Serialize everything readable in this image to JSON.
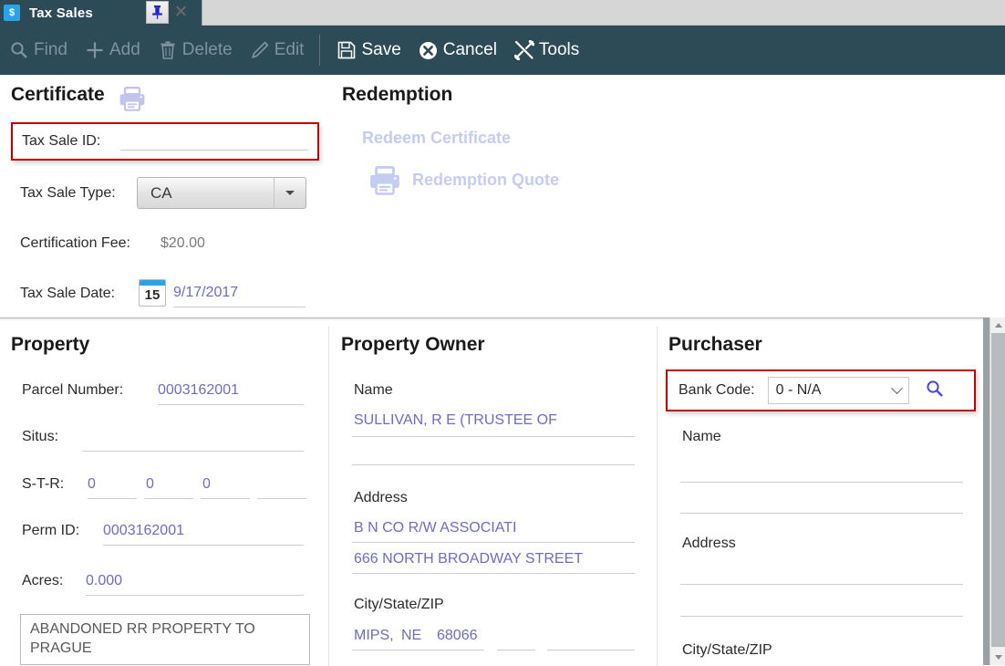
{
  "tab": {
    "app_icon": "tax-sales-app-icon",
    "title": "Tax Sales",
    "pin_glyph": "↓",
    "close_glyph": "✕"
  },
  "toolbar": {
    "items": [
      {
        "label": "Find",
        "icon": "search-icon",
        "enabled": false
      },
      {
        "label": "Add",
        "icon": "plus-icon",
        "enabled": false
      },
      {
        "label": "Delete",
        "icon": "trash-icon",
        "enabled": false
      },
      {
        "label": "Edit",
        "icon": "pencil-icon",
        "enabled": false
      },
      {
        "label": "Save",
        "icon": "floppy-disk-icon",
        "enabled": true
      },
      {
        "label": "Cancel",
        "icon": "cancel-circle-icon",
        "enabled": true
      },
      {
        "label": "Tools",
        "icon": "tools-icon",
        "enabled": true
      }
    ]
  },
  "certificate": {
    "title": "Certificate",
    "print_icon": "printer-icon",
    "tax_sale_id": {
      "label": "Tax Sale ID:",
      "value": "",
      "placeholder": ""
    },
    "tax_sale_type": {
      "label": "Tax Sale Type:",
      "value": "CA",
      "options": [
        "CA"
      ]
    },
    "certification_fee": {
      "label": "Certification Fee:",
      "value": "$20.00"
    },
    "tax_sale_date": {
      "label": "Tax Sale Date:",
      "value": "9/17/2017",
      "calendar_day": "15"
    }
  },
  "redemption": {
    "title": "Redemption",
    "redeem_certificate_label": "Redeem Certificate",
    "redemption_quote_label": "Redemption Quote",
    "quote_icon": "printer-icon"
  },
  "property": {
    "title": "Property",
    "fields": [
      {
        "label": "Parcel Number:",
        "value": "0003162001"
      },
      {
        "label": "Situs:",
        "value": ""
      },
      {
        "label": "S-T-R:",
        "value": ""
      },
      {
        "label": "Perm ID:",
        "value": "0003162001"
      },
      {
        "label": "Acres:",
        "value": "0.000"
      }
    ],
    "str_values": [
      "0",
      "0",
      "0",
      ""
    ],
    "description": "ABANDONED RR PROPERTY TO PRAGUE"
  },
  "property_owner": {
    "title": "Property Owner",
    "name_label": "Name",
    "name_lines": [
      "SULLIVAN, R E (TRUSTEE OF",
      ""
    ],
    "address_label": "Address",
    "address_lines": [
      "B N CO R/W ASSOCIATI",
      "666 NORTH BROADWAY STREET"
    ],
    "citystatezip_label": "City/State/ZIP",
    "city": "MIPS,",
    "state": "NE",
    "zip": "68066"
  },
  "purchaser": {
    "title": "Purchaser",
    "bank_code": {
      "label": "Bank Code:",
      "value": "0 - N/A",
      "options": [
        "0 - N/A"
      ]
    },
    "search_icon": "search-icon",
    "name_label": "Name",
    "name_lines": [
      "",
      ""
    ],
    "address_label": "Address",
    "address_lines": [
      "",
      ""
    ],
    "citystatezip_label": "City/State/ZIP"
  },
  "colors": {
    "toolbar_bg": "#2d4a57",
    "accent_blue": "#2aa4e8",
    "value_purple": "#6d6dc4",
    "highlight_red": "#c00000",
    "disabled_link": "#c3cdf2"
  },
  "scrollbar": {
    "up_glyph": "▲",
    "down_glyph": "▼"
  }
}
